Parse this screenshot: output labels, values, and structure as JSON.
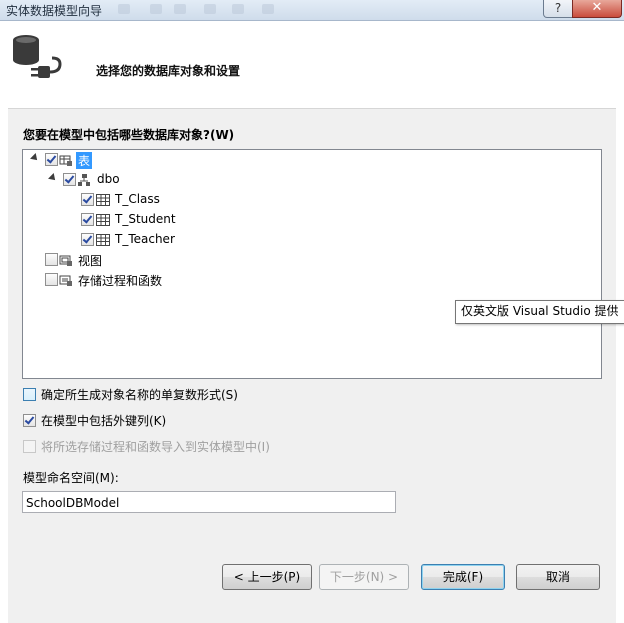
{
  "window": {
    "title": "实体数据模型向导",
    "help_label": "?",
    "close_label": "✕"
  },
  "header": {
    "title": "选择您的数据库对象和设置"
  },
  "objects_prompt": "您要在模型中包括哪些数据库对象?(W)",
  "tree": {
    "tables": {
      "label": "表",
      "checked": true,
      "expanded": true
    },
    "schema": {
      "label": "dbo",
      "checked": true,
      "expanded": true
    },
    "tables_list": [
      {
        "label": "T_Class",
        "checked": true
      },
      {
        "label": "T_Student",
        "checked": true
      },
      {
        "label": "T_Teacher",
        "checked": true
      }
    ],
    "views": {
      "label": "视图",
      "checked": false
    },
    "procs": {
      "label": "存储过程和函数",
      "checked": false
    }
  },
  "options": {
    "pluralize": {
      "label": "确定所生成对象名称的单复数形式(S)",
      "checked": false
    },
    "foreign_keys": {
      "label": "在模型中包括外键列(K)",
      "checked": true
    },
    "import_procs": {
      "label": "将所选存储过程和函数导入到实体模型中(I)",
      "checked": false,
      "enabled": false
    }
  },
  "tooltip": "仅英文版 Visual Studio 提供",
  "namespace": {
    "label": "模型命名空间(M):",
    "value": "SchoolDBModel"
  },
  "buttons": {
    "back": "< 上一步(P)",
    "next": "下一步(N) >",
    "finish": "完成(F)",
    "cancel": "取消"
  }
}
